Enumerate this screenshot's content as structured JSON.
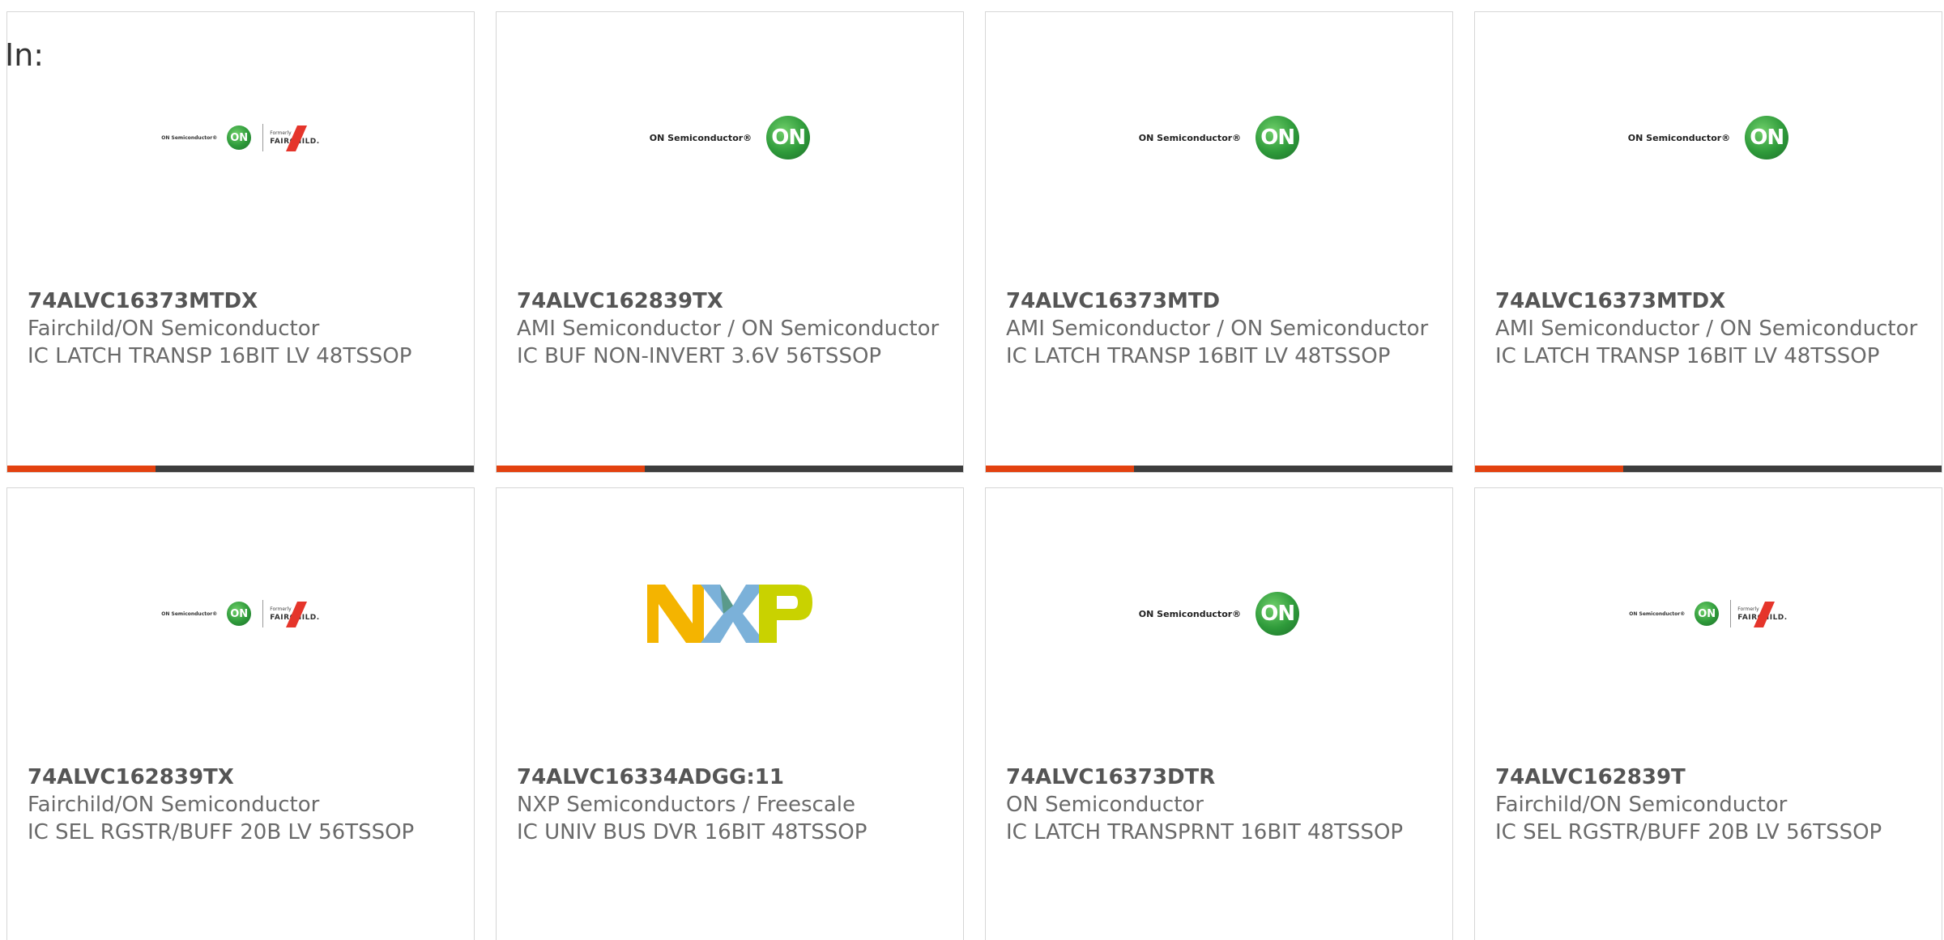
{
  "page": {
    "in_label": "In:"
  },
  "logos": {
    "on_text": "ON Semiconductor®",
    "on_mark": "ON",
    "fc_on_text": "ON Semiconductor®",
    "fc_formerly": "Formerly",
    "fc_name": "FAIRCHILD."
  },
  "colors": {
    "accent": "#e3410f",
    "bar": "#3d3d3d",
    "on_green": "#2e9a3a",
    "fairchild_red": "#e5352b",
    "nxp_yellow": "#f4b400",
    "nxp_blue": "#7bb1d9",
    "nxp_green": "#c9d200"
  },
  "products": [
    {
      "part": "74ALVC16373MTDX",
      "maker": "Fairchild/ON Semiconductor",
      "desc": "IC LATCH TRANSP 16BIT LV 48TSSOP",
      "logo": "fairchild-on-logo"
    },
    {
      "part": "74ALVC162839TX",
      "maker": "AMI Semiconductor / ON Semiconductor",
      "desc": "IC BUF NON-INVERT 3.6V 56TSSOP",
      "logo": "on-semiconductor-logo"
    },
    {
      "part": "74ALVC16373MTD",
      "maker": "AMI Semiconductor / ON Semiconductor",
      "desc": "IC LATCH TRANSP 16BIT LV 48TSSOP",
      "logo": "on-semiconductor-logo"
    },
    {
      "part": "74ALVC16373MTDX",
      "maker": "AMI Semiconductor / ON Semiconductor",
      "desc": "IC LATCH TRANSP 16BIT LV 48TSSOP",
      "logo": "on-semiconductor-logo"
    },
    {
      "part": "74ALVC162839TX",
      "maker": "Fairchild/ON Semiconductor",
      "desc": "IC SEL RGSTR/BUFF 20B LV 56TSSOP",
      "logo": "fairchild-on-logo"
    },
    {
      "part": "74ALVC16334ADGG:11",
      "maker": "NXP Semiconductors / Freescale",
      "desc": "IC UNIV BUS DVR 16BIT 48TSSOP",
      "logo": "nxp-logo"
    },
    {
      "part": "74ALVC16373DTR",
      "maker": "ON Semiconductor",
      "desc": "IC LATCH TRANSPRNT 16BIT 48TSSOP",
      "logo": "on-semiconductor-logo"
    },
    {
      "part": "74ALVC162839T",
      "maker": "Fairchild/ON Semiconductor",
      "desc": "IC SEL RGSTR/BUFF 20B LV 56TSSOP",
      "logo": "fairchild-on-logo"
    }
  ]
}
